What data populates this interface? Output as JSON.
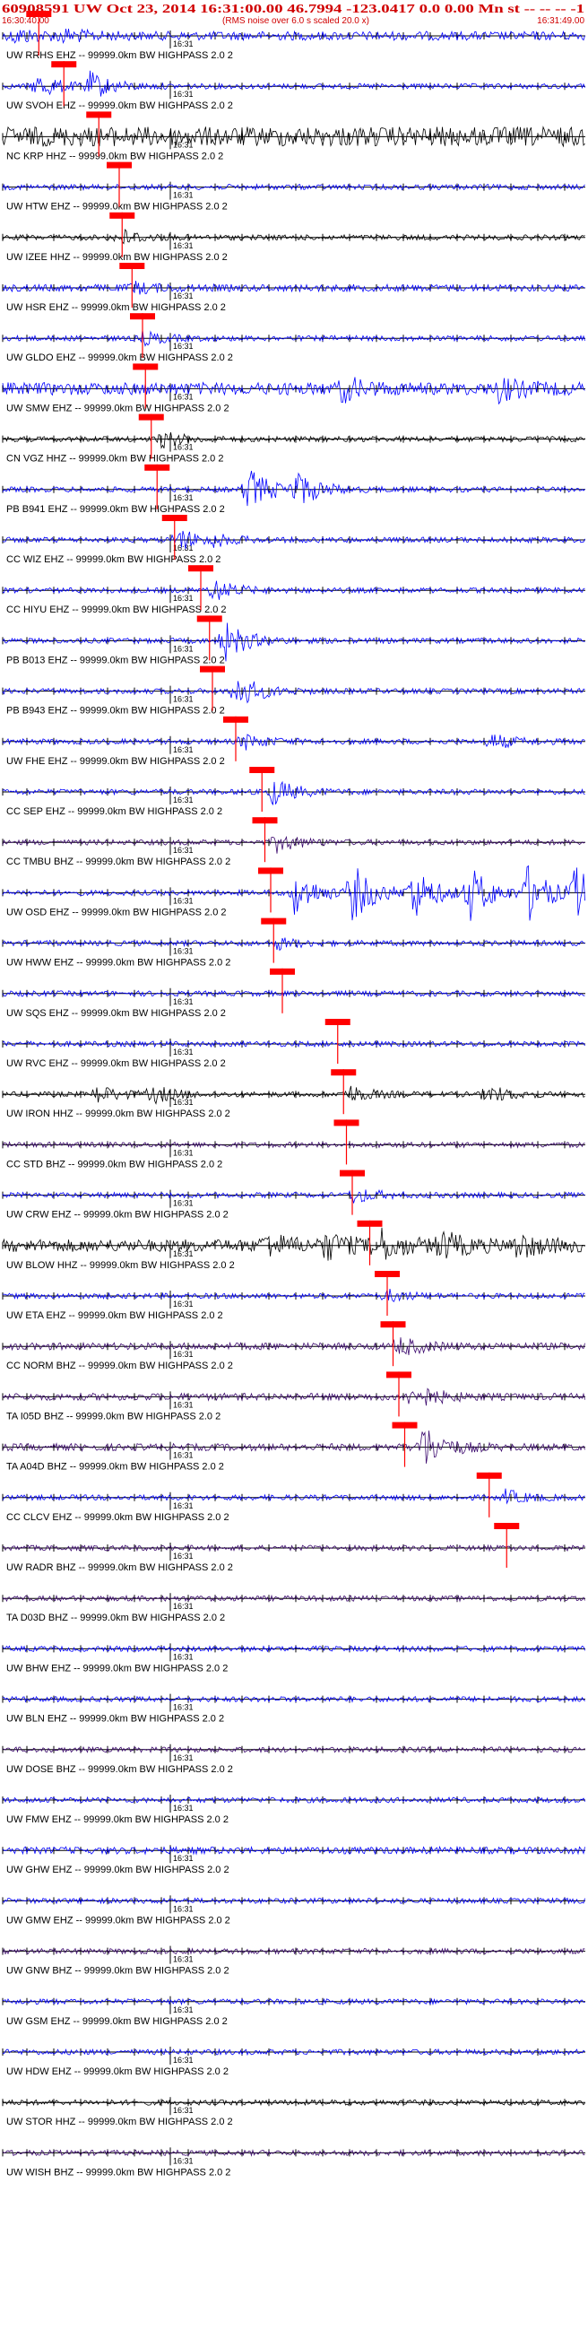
{
  "header": {
    "title": "60908591 UW Oct 23, 2014 16:31:00.00   46.7994 -123.0417  0.0 0.00 Mn st -- -- -- -1",
    "start_time": "16:30:40.00",
    "end_time": "16:31:49.00",
    "note": "(RMS noise over 6.0 s scaled 20.0 x)"
  },
  "minute_label": "16:31",
  "chart_data": {
    "type": "line",
    "subtype": "seismogram-record-section",
    "x_range": [
      "16:30:40.00",
      "16:31:49.00"
    ],
    "colors": {
      "blue": "#0000ff",
      "black": "#000000",
      "purple": "#3c0a6e",
      "pick": "#ff0000"
    },
    "traces": [
      {
        "label": "UW RRHS EHZ -- 99999.0km BW HIGHPASS  2.0  2",
        "color": "#0000ff",
        "amp": 5,
        "pick": 0.062,
        "events": [
          [
            0.02,
            7
          ],
          [
            0.1,
            6
          ]
        ]
      },
      {
        "label": "UW SVOH EHZ -- 99999.0km BW HIGHPASS  2.0  2",
        "color": "#0000ff",
        "amp": 3,
        "pick": 0.105,
        "events": [
          [
            0.058,
            14
          ],
          [
            0.15,
            14
          ]
        ]
      },
      {
        "label": "NC KRP HHZ -- 99999.0km BW HIGHPASS  2.0  2",
        "color": "#000000",
        "amp": 11,
        "pick": 0.165,
        "events": []
      },
      {
        "label": "UW HTW EHZ -- 99999.0km BW HIGHPASS  2.0  2",
        "color": "#0000ff",
        "amp": 3,
        "pick": 0.2,
        "events": []
      },
      {
        "label": "UW IZEE HHZ -- 99999.0km BW HIGHPASS  2.0  2",
        "color": "#000000",
        "amp": 3,
        "pick": 0.205,
        "events": [
          [
            0.2,
            9
          ]
        ]
      },
      {
        "label": "UW HSR EHZ -- 99999.0km BW HIGHPASS  2.0  2",
        "color": "#0000ff",
        "amp": 4,
        "pick": 0.222,
        "events": [
          [
            0.22,
            6
          ]
        ]
      },
      {
        "label": "UW GLDO EHZ -- 99999.0km BW HIGHPASS  2.0  2",
        "color": "#0000ff",
        "amp": 3,
        "pick": 0.24,
        "events": [
          [
            0.24,
            7
          ]
        ]
      },
      {
        "label": "UW SMW EHZ -- 99999.0km BW HIGHPASS  2.0  2",
        "color": "#0000ff",
        "amp": 7,
        "pick": 0.245,
        "events": [
          [
            0.58,
            12
          ],
          [
            0.85,
            11
          ]
        ]
      },
      {
        "label": "CN VGZ HHZ -- 99999.0km BW HIGHPASS  2.0  2",
        "color": "#000000",
        "amp": 3,
        "pick": 0.255,
        "events": [
          [
            0.27,
            9
          ]
        ]
      },
      {
        "label": "PB B941 EHZ -- 99999.0km BW HIGHPASS  2.0  2",
        "color": "#0000ff",
        "amp": 3,
        "pick": 0.265,
        "events": [
          [
            0.42,
            24
          ],
          [
            0.5,
            20
          ]
        ]
      },
      {
        "label": "CC WIZ EHZ -- 99999.0km BW HIGHPASS  2.0  2",
        "color": "#0000ff",
        "amp": 3,
        "pick": 0.295,
        "events": [
          [
            0.3,
            12
          ],
          [
            0.36,
            5
          ]
        ]
      },
      {
        "label": "CC HIYU EHZ -- 99999.0km BW HIGHPASS  2.0  2",
        "color": "#0000ff",
        "amp": 3,
        "pick": 0.34,
        "events": [
          [
            0.36,
            12
          ]
        ]
      },
      {
        "label": "PB B013 EHZ -- 99999.0km BW HIGHPASS  2.0  2",
        "color": "#0000ff",
        "amp": 3,
        "pick": 0.355,
        "events": [
          [
            0.38,
            22
          ]
        ]
      },
      {
        "label": "PB B943 EHZ -- 99999.0km BW HIGHPASS  2.0  2",
        "color": "#0000ff",
        "amp": 3,
        "pick": 0.36,
        "events": [
          [
            0.4,
            20
          ]
        ]
      },
      {
        "label": "UW FHE EHZ -- 99999.0km BW HIGHPASS  2.0  2",
        "color": "#0000ff",
        "amp": 3,
        "pick": 0.4,
        "events": [
          [
            0.41,
            9
          ],
          [
            0.84,
            8
          ]
        ]
      },
      {
        "label": "CC SEP EHZ -- 99999.0km BW HIGHPASS  2.0  2",
        "color": "#0000ff",
        "amp": 3,
        "pick": 0.445,
        "events": [
          [
            0.46,
            16
          ]
        ]
      },
      {
        "label": "CC TMBU BHZ -- 99999.0km BW HIGHPASS  2.0  2",
        "color": "#3c0a6e",
        "amp": 3,
        "pick": 0.45,
        "events": [
          [
            0.47,
            10
          ]
        ]
      },
      {
        "label": "UW OSD EHZ -- 99999.0km BW HIGHPASS  2.0  2",
        "color": "#0000ff",
        "amp": 3,
        "pick": 0.46,
        "events": [
          [
            0.5,
            24
          ],
          [
            0.6,
            30
          ],
          [
            0.7,
            30
          ],
          [
            0.8,
            30
          ],
          [
            0.9,
            30
          ],
          [
            0.98,
            28
          ]
        ]
      },
      {
        "label": "UW HWW EHZ -- 99999.0km BW HIGHPASS  2.0  2",
        "color": "#0000ff",
        "amp": 3,
        "pick": 0.465,
        "events": [
          [
            0.47,
            6
          ]
        ]
      },
      {
        "label": "UW SQS EHZ -- 99999.0km BW HIGHPASS  2.0  2",
        "color": "#0000ff",
        "amp": 3,
        "pick": 0.48,
        "events": []
      },
      {
        "label": "UW RVC EHZ -- 99999.0km BW HIGHPASS  2.0  2",
        "color": "#0000ff",
        "amp": 3,
        "pick": 0.575,
        "events": []
      },
      {
        "label": "UW IRON HHZ -- 99999.0km BW HIGHPASS  2.0  2",
        "color": "#000000",
        "amp": 3,
        "pick": 0.585,
        "events": [
          [
            0.16,
            10
          ],
          [
            0.255,
            9
          ],
          [
            0.59,
            10
          ],
          [
            0.83,
            10
          ]
        ]
      },
      {
        "label": "CC STD BHZ -- 99999.0km BW HIGHPASS  2.0  2",
        "color": "#3c0a6e",
        "amp": 3,
        "pick": 0.59,
        "events": []
      },
      {
        "label": "UW CRW EHZ -- 99999.0km BW HIGHPASS  2.0  2",
        "color": "#0000ff",
        "amp": 3,
        "pick": 0.6,
        "events": [
          [
            0.6,
            9
          ]
        ]
      },
      {
        "label": "UW BLOW HHZ -- 99999.0km BW HIGHPASS  2.0  2",
        "color": "#000000",
        "amp": 7,
        "pick": 0.63,
        "events": [
          [
            0.45,
            12
          ],
          [
            0.55,
            14
          ],
          [
            0.64,
            18
          ],
          [
            0.75,
            14
          ],
          [
            0.88,
            12
          ]
        ]
      },
      {
        "label": "UW ETA EHZ -- 99999.0km BW HIGHPASS  2.0  2",
        "color": "#0000ff",
        "amp": 3,
        "pick": 0.66,
        "events": [
          [
            0.66,
            6
          ]
        ]
      },
      {
        "label": "CC NORM BHZ -- 99999.0km BW HIGHPASS  2.0  2",
        "color": "#3c0a6e",
        "amp": 4,
        "pick": 0.67,
        "events": [
          [
            0.68,
            10
          ]
        ]
      },
      {
        "label": "TA I05D BHZ -- 99999.0km BW HIGHPASS  2.0  2",
        "color": "#3c0a6e",
        "amp": 4,
        "pick": 0.68,
        "events": [
          [
            0.7,
            16
          ]
        ]
      },
      {
        "label": "TA A04D BHZ -- 99999.0km BW HIGHPASS  2.0  2",
        "color": "#3c0a6e",
        "amp": 4,
        "pick": 0.69,
        "events": [
          [
            0.72,
            24
          ]
        ]
      },
      {
        "label": "CC CLCV EHZ -- 99999.0km BW HIGHPASS  2.0  2",
        "color": "#0000ff",
        "amp": 3,
        "pick": 0.835,
        "events": [
          [
            0.86,
            8
          ]
        ]
      },
      {
        "label": "UW RADR BHZ -- 99999.0km BW HIGHPASS  2.0  2",
        "color": "#3c0a6e",
        "amp": 3,
        "pick": 0.865,
        "events": []
      },
      {
        "label": "TA D03D BHZ -- 99999.0km BW HIGHPASS  2.0  2",
        "color": "#3c0a6e",
        "amp": 3,
        "pick": null,
        "events": []
      },
      {
        "label": "UW BHW EHZ -- 99999.0km BW HIGHPASS  2.0  2",
        "color": "#0000ff",
        "amp": 3,
        "pick": null,
        "events": []
      },
      {
        "label": "UW BLN EHZ -- 99999.0km BW HIGHPASS  2.0  2",
        "color": "#0000ff",
        "amp": 3,
        "pick": null,
        "events": []
      },
      {
        "label": "UW DOSE BHZ -- 99999.0km BW HIGHPASS  2.0  2",
        "color": "#3c0a6e",
        "amp": 3,
        "pick": null,
        "events": []
      },
      {
        "label": "UW FMW EHZ -- 99999.0km BW HIGHPASS  2.0  2",
        "color": "#0000ff",
        "amp": 3,
        "pick": null,
        "events": []
      },
      {
        "label": "UW GHW EHZ -- 99999.0km BW HIGHPASS  2.0  2",
        "color": "#0000ff",
        "amp": 4,
        "pick": null,
        "events": []
      },
      {
        "label": "UW GMW EHZ -- 99999.0km BW HIGHPASS  2.0  2",
        "color": "#0000ff",
        "amp": 3,
        "pick": null,
        "events": []
      },
      {
        "label": "UW GNW BHZ -- 99999.0km BW HIGHPASS  2.0  2",
        "color": "#3c0a6e",
        "amp": 3,
        "pick": null,
        "events": []
      },
      {
        "label": "UW GSM EHZ -- 99999.0km BW HIGHPASS  2.0  2",
        "color": "#0000ff",
        "amp": 3,
        "pick": null,
        "events": []
      },
      {
        "label": "UW HDW EHZ -- 99999.0km BW HIGHPASS  2.0  2",
        "color": "#0000ff",
        "amp": 3,
        "pick": null,
        "events": []
      },
      {
        "label": "UW STOR HHZ -- 99999.0km BW HIGHPASS  2.0  2",
        "color": "#000000",
        "amp": 3,
        "pick": null,
        "events": []
      },
      {
        "label": "UW WISH BHZ -- 99999.0km BW HIGHPASS  2.0  2",
        "color": "#3c0a6e",
        "amp": 3,
        "pick": null,
        "events": []
      }
    ]
  }
}
